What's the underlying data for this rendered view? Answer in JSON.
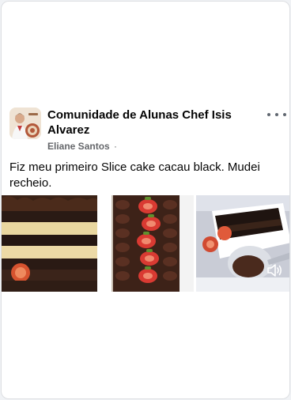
{
  "post": {
    "group_name": "Comunidade de Alunas Chef Isis Alvarez",
    "author": "Eliane Santos",
    "separator": "·",
    "text": "Fiz meu primeiro Slice cake cacau black. Mudei recheio."
  },
  "icons": {
    "more": "more-horizontal-icon",
    "sound": "speaker-icon"
  },
  "colors": {
    "card_background": "#ffffff",
    "primary_text": "#050505",
    "secondary_text": "#65676b"
  }
}
